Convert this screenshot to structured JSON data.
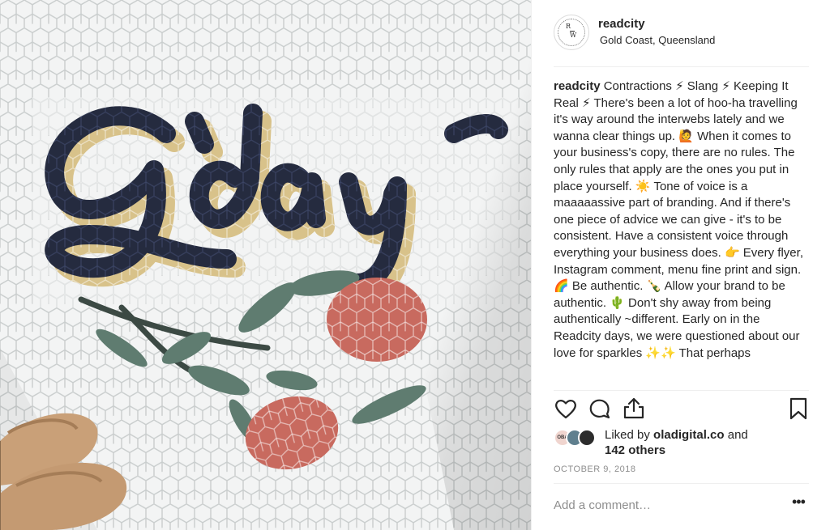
{
  "post": {
    "username": "readcity",
    "location": "Gold Coast, Queensland",
    "logo_letters": {
      "top": "R",
      "bottom": "W"
    },
    "caption_user": "readcity",
    "caption_text": " Contractions ⚡ Slang ⚡ Keeping It Real ⚡ There's been a lot of hoo-ha travelling it's way around the interwebs lately and we wanna clear things up. 🙋 When it comes to your business's copy, there are no rules.  The only rules that apply are the ones you put in place yourself. ☀️ Tone of voice is a maaaaassive part of branding.  And if there's one piece of advice we can give - it's to be consistent.  Have a consistent voice through everything your business does. 👉 Every flyer, Instagram comment, menu fine print and sign. 🌈 Be authentic. 🍾 Allow your brand to be authentic. 🌵 Don't shy away from being authentically ~different.  Early on in the Readcity days, we were questioned about our love for sparkles ✨✨  That perhaps",
    "likes_prefix": "Liked by ",
    "likes_user": "oladigital.co",
    "likes_and": " and",
    "likes_others": "142 others",
    "avatar_label": "OBA",
    "date": "OCTOBER 9, 2018",
    "comment_placeholder": "Add a comment…",
    "more_label": "•••"
  },
  "photo": {
    "mosaic_text": "G'day",
    "colors": {
      "tile_grout": "#c9cdcd",
      "tile": "#f3f4f4",
      "script_navy": "#252b3f",
      "script_gold": "#d8c28a",
      "flower_red": "#c86a5f",
      "leaf_green": "#5f7c70",
      "shoe_tan": "#c9a078"
    }
  },
  "icons": [
    "heart-icon",
    "comment-icon",
    "share-icon",
    "bookmark-icon"
  ]
}
